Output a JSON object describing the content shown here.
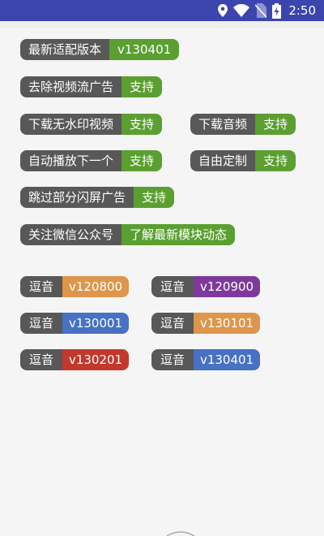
{
  "status_bar": {
    "time": "2:50",
    "background": "#3c45ad",
    "icons": [
      "location-icon",
      "wifi-icon",
      "no-sim-icon",
      "battery-charging-icon"
    ]
  },
  "colors": {
    "label_gray": "#585858",
    "green": "#5a9f2f",
    "orange": "#dd964b",
    "purple": "#7d3a9a",
    "blue": "#4671c4",
    "red": "#c3382c"
  },
  "features": {
    "latest": {
      "label": "最新适配版本",
      "value": "v130401"
    },
    "remove_ads": {
      "label": "去除视频流广告",
      "value": "支持"
    },
    "download_no_watermark": {
      "label": "下载无水印视频",
      "value": "支持"
    },
    "download_audio": {
      "label": "下载音频",
      "value": "支持"
    },
    "autoplay_next": {
      "label": "自动播放下一个",
      "value": "支持"
    },
    "custom": {
      "label": "自由定制",
      "value": "支持"
    },
    "skip_splash_ads": {
      "label": "跳过部分闪屏广告",
      "value": "支持"
    },
    "follow_wechat": {
      "label": "关注微信公众号",
      "value": "了解最新模块动态"
    }
  },
  "versions": [
    {
      "label": "逗音",
      "value": "v120800"
    },
    {
      "label": "逗音",
      "value": "v120900"
    },
    {
      "label": "逗音",
      "value": "v130001"
    },
    {
      "label": "逗音",
      "value": "v130101"
    },
    {
      "label": "逗音",
      "value": "v130201"
    },
    {
      "label": "逗音",
      "value": "v130401"
    }
  ]
}
